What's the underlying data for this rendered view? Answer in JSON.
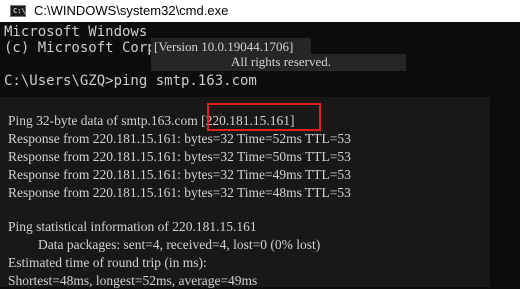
{
  "window": {
    "title": "C:\\WINDOWS\\system32\\cmd.exe",
    "icon_glyph": "C:\\",
    "icon": "terminal-icon"
  },
  "console": {
    "banner_line1": "Microsoft Windows",
    "banner_line2": "(c) Microsoft Corp",
    "overlay_version": "[Version 10.0.19044.1706]",
    "overlay_rights": "All rights reserved.",
    "prompt_line": "C:\\Users\\GZQ>ping smtp.163.com"
  },
  "output": {
    "ping_header_prefix": "Ping 32-byte data of smtp.163.com",
    "ping_header_ip": "[220.181.15.161]",
    "responses": [
      "Response from 220.181.15.161: bytes=32 Time=52ms TTL=53",
      "Response from 220.181.15.161: bytes=32 Time=50ms TTL=53",
      "Response from 220.181.15.161: bytes=32 Time=49ms TTL=53",
      "Response from 220.181.15.161: bytes=32 Time=48ms TTL=53"
    ],
    "stats_header": "Ping statistical information of 220.181.15.161",
    "stats_packets": "Data packages: sent=4, received=4, lost=0 (0% lost)",
    "rtt_header": "Estimated time of round trip (in ms):",
    "rtt_values": "Shortest=48ms, longest=52ms, average=49ms"
  },
  "colors": {
    "background": "#0c0c0c",
    "text": "#cccccc",
    "highlight": "#e02020"
  }
}
